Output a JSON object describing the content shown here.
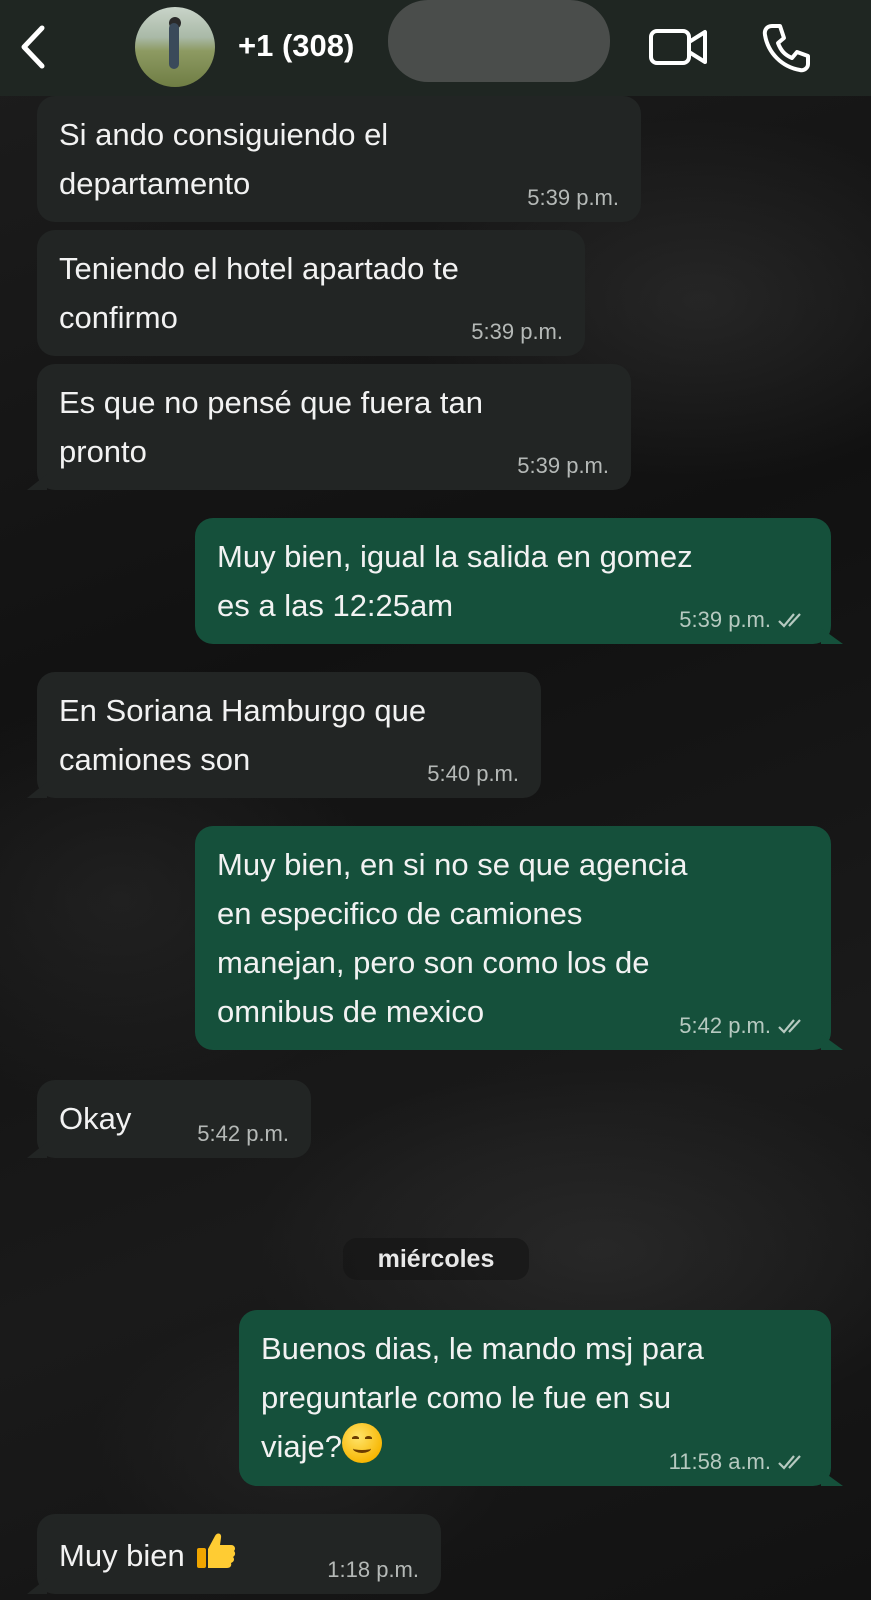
{
  "header": {
    "contact": "+1 (308)",
    "back_icon": "chevron-left-icon",
    "video_icon": "video-camera-icon",
    "call_icon": "phone-icon"
  },
  "colors": {
    "incoming_bubble": "#222524",
    "outgoing_bubble": "#15503b",
    "header": "#1f2622"
  },
  "messages": [
    {
      "dir": "in",
      "lines": [
        "Si ando consiguiendo el",
        "departamento"
      ],
      "time": "5:39 p.m."
    },
    {
      "dir": "in",
      "lines": [
        "Teniendo el hotel apartado te",
        "confirmo"
      ],
      "time": "5:39 p.m."
    },
    {
      "dir": "in",
      "lines": [
        "Es que no pensé que fuera tan",
        "pronto"
      ],
      "time": "5:39 p.m."
    },
    {
      "dir": "out",
      "lines": [
        "Muy bien, igual la salida en gomez",
        "es a las 12:25am"
      ],
      "time": "5:39 p.m.",
      "status": "read"
    },
    {
      "dir": "in",
      "lines": [
        "En Soriana Hamburgo que",
        "camiones son"
      ],
      "time": "5:40 p.m."
    },
    {
      "dir": "out",
      "lines": [
        "Muy bien, en si no se que agencia",
        "en especifico de camiones",
        "manejan, pero son como los de",
        "omnibus de mexico"
      ],
      "time": "5:42 p.m.",
      "status": "read"
    },
    {
      "dir": "in",
      "lines": [
        "Okay"
      ],
      "time": "5:42 p.m."
    },
    {
      "dir": "out",
      "lines": [
        "Buenos dias, le mando msj para",
        "preguntarle como le fue en su",
        "viaje?"
      ],
      "time": "11:58 a.m.",
      "status": "read",
      "emoji": "smiling-face-emoji"
    },
    {
      "dir": "in",
      "lines": [
        "Muy bien"
      ],
      "time": "1:18 p.m.",
      "emoji": "thumbs-up-emoji"
    }
  ],
  "day_separator": "miércoles"
}
